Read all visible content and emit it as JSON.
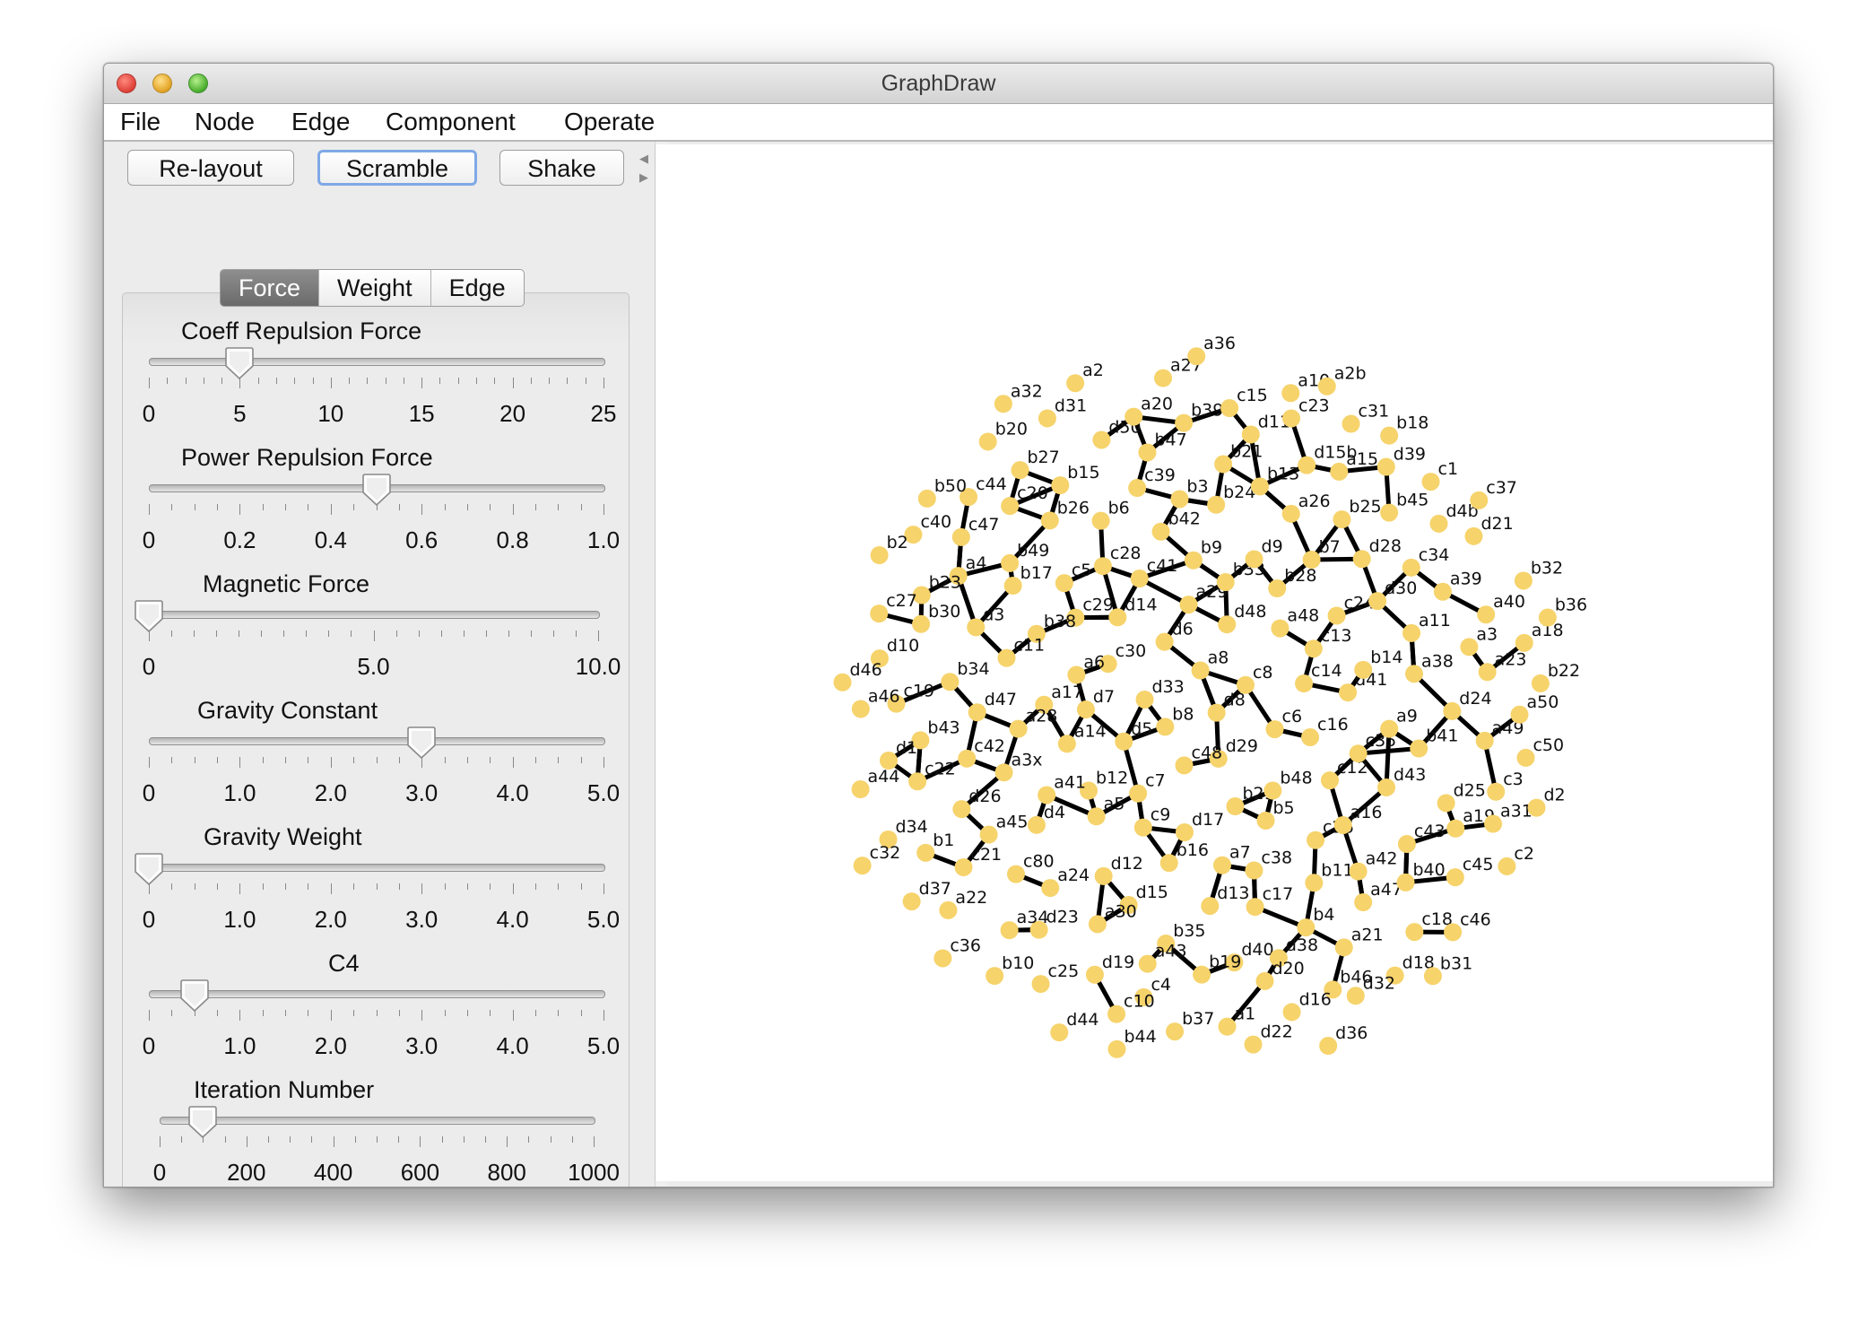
{
  "window": {
    "title": "GraphDraw"
  },
  "menu": [
    "File",
    "Node",
    "Edge",
    "Component",
    "Operate"
  ],
  "toolbar": {
    "relayout": "Re-layout",
    "scramble": "Scramble",
    "shake": "Shake"
  },
  "tabs": [
    {
      "label": "Force",
      "active": true
    },
    {
      "label": "Weight",
      "active": false
    },
    {
      "label": "Edge",
      "active": false
    }
  ],
  "sliders": [
    {
      "label": "Coeff Repulsion Force",
      "min": 0,
      "max": 25,
      "value": 5,
      "minor_ticks": 25,
      "major_ticks": 5,
      "tick_labels": [
        "0",
        "5",
        "10",
        "15",
        "20",
        "25"
      ]
    },
    {
      "label": "Power Repulsion Force",
      "min": 0,
      "max": 1,
      "value": 0.5,
      "minor_ticks": 20,
      "major_ticks": 5,
      "tick_labels": [
        "0",
        "0.2",
        "0.4",
        "0.6",
        "0.8",
        "1.0"
      ]
    },
    {
      "label": "Magnetic Force",
      "min": 0,
      "max": 10,
      "value": 0,
      "minor_ticks": 20,
      "major_ticks": 2,
      "tick_labels": [
        "0",
        "5.0",
        "10.0"
      ]
    },
    {
      "label": "Gravity Constant",
      "min": 0,
      "max": 5,
      "value": 3,
      "minor_ticks": 20,
      "major_ticks": 5,
      "tick_labels": [
        "0",
        "1.0",
        "2.0",
        "3.0",
        "4.0",
        "5.0"
      ]
    },
    {
      "label": "Gravity Weight",
      "min": 0,
      "max": 5,
      "value": 0,
      "minor_ticks": 20,
      "major_ticks": 5,
      "tick_labels": [
        "0",
        "1.0",
        "2.0",
        "3.0",
        "4.0",
        "5.0"
      ]
    },
    {
      "label": "C4",
      "min": 0,
      "max": 5,
      "value": 0.5,
      "minor_ticks": 20,
      "major_ticks": 5,
      "tick_labels": [
        "0",
        "1.0",
        "2.0",
        "3.0",
        "4.0",
        "5.0"
      ]
    },
    {
      "label": "Iteration Number",
      "min": 0,
      "max": 1000,
      "value": 100,
      "minor_ticks": 20,
      "major_ticks": 5,
      "tick_labels": [
        "0",
        "200",
        "400",
        "600",
        "800",
        "1000"
      ]
    }
  ],
  "graph": {
    "node_color": "#f6d36b",
    "edge_color": "#000000",
    "nodes": [
      "d8",
      "b8",
      "a8",
      "d29",
      "d33",
      "c8",
      "c48",
      "d6",
      "c6",
      "d5",
      "d48",
      "b29",
      "c30",
      "c14",
      "c7",
      "a29",
      "b48",
      "d7",
      "a48",
      "d17",
      "d14",
      "c16",
      "b12",
      "b33",
      "b5",
      "a6",
      "c13",
      "c9",
      "c41",
      "c12",
      "a14",
      "b28",
      "a7",
      "c29",
      "d41",
      "a5",
      "b9",
      "c26",
      "a17",
      "c24",
      "b16",
      "c28",
      "c35",
      "a41",
      "d9",
      "c38",
      "b38",
      "b14",
      "d12",
      "b42",
      "a16",
      "a28",
      "b7",
      "d13",
      "c5",
      "a9",
      "d4",
      "b24",
      "b11",
      "c11",
      "d30",
      "d15",
      "b6",
      "d43",
      "a3x",
      "a26",
      "c17",
      "b17",
      "a38",
      "a24",
      "b3",
      "a42",
      "d47",
      "d28",
      "b35",
      "b26",
      "b41",
      "a45",
      "b13",
      "b4",
      "d3",
      "a11",
      "a30",
      "c39",
      "c43",
      "c42",
      "b25",
      "d40",
      "b49",
      "d24",
      "c80",
      "b21",
      "a47",
      "b34",
      "c34",
      "a43",
      "b15",
      "d25",
      "d26",
      "d15b",
      "d38",
      "a4",
      "a3",
      "d23",
      "b47",
      "b40",
      "b43",
      "b45",
      "b19",
      "c20",
      "a49",
      "c21",
      "d11",
      "a21",
      "b30",
      "a39",
      "d19",
      "d50",
      "a19",
      "c22",
      "a15",
      "d20",
      "c47",
      "a23",
      "a34",
      "b39",
      "c18",
      "c19",
      "d4b",
      "c4",
      "b27",
      "c3",
      "b1",
      "c23",
      "b46",
      "b23",
      "a40",
      "c25",
      "a20",
      "c45",
      "d1",
      "d39",
      "a1",
      "c44",
      "a50",
      "a22",
      "c15",
      "d18",
      "d10",
      "d21",
      "c10",
      "d31",
      "a31",
      "d34",
      "c31",
      "d16",
      "c40",
      "a18",
      "b10",
      "a27",
      "c46",
      "a46",
      "c1",
      "b37",
      "b20",
      "c50",
      "d37",
      "a10",
      "d32",
      "c27",
      "b32",
      "d44",
      "a2",
      "c2",
      "a44",
      "b18",
      "d22",
      "b50",
      "b22",
      "c36",
      "a36",
      "b31",
      "d46",
      "c37",
      "b44",
      "a32",
      "d2",
      "c32",
      "a2b",
      "d36",
      "b2",
      "b36"
    ],
    "edges": 227
  }
}
